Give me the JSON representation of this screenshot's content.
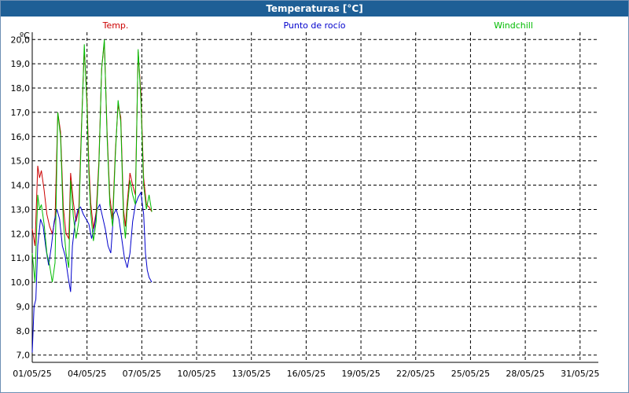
{
  "window": {
    "title": "Temperaturas [°C]"
  },
  "colors": {
    "titlebar": "#1e5f96",
    "temp": "#cc0000",
    "dew": "#0000cc",
    "windchill": "#00bb00"
  },
  "chart_data": {
    "type": "line",
    "title": "Temperaturas [°C]",
    "ylabel": "ºC",
    "xlabel": "",
    "ylim": [
      6.7,
      20.3
    ],
    "yticks": [
      "7,0",
      "8,0",
      "9,0",
      "10,0",
      "11,0",
      "12,0",
      "13,0",
      "14,0",
      "15,0",
      "16,0",
      "17,0",
      "18,0",
      "19,0",
      "20,0"
    ],
    "ytick_values": [
      7,
      8,
      9,
      10,
      11,
      12,
      13,
      14,
      15,
      16,
      17,
      18,
      19,
      20
    ],
    "xlim": [
      1,
      32
    ],
    "xticks": [
      "01/05/25",
      "04/05/25",
      "07/05/25",
      "10/05/25",
      "13/05/25",
      "16/05/25",
      "19/05/25",
      "22/05/25",
      "25/05/25",
      "28/05/25",
      "31/05/25"
    ],
    "xtick_values": [
      1,
      4,
      7,
      10,
      13,
      16,
      19,
      22,
      25,
      28,
      31
    ],
    "grid": true,
    "legend_position": "top",
    "series": [
      {
        "name": "Temp.",
        "color": "#cc0000",
        "x": [
          1.0,
          1.15,
          1.3,
          1.4,
          1.5,
          1.65,
          1.8,
          1.95,
          2.1,
          2.25,
          2.4,
          2.55,
          2.7,
          2.85,
          3.0,
          3.1,
          3.25,
          3.4,
          3.55,
          3.7,
          3.85,
          4.0,
          4.1,
          4.2,
          4.35,
          4.5,
          4.65,
          4.8,
          4.95,
          5.1,
          5.25,
          5.4,
          5.55,
          5.7,
          5.85,
          6.0,
          6.1,
          6.2,
          6.35,
          6.5,
          6.65,
          6.8,
          6.95,
          7.1,
          7.25,
          7.4,
          7.55
        ],
        "y": [
          12.2,
          11.5,
          14.8,
          14.3,
          14.6,
          13.8,
          12.8,
          12.3,
          12.0,
          12.6,
          17.0,
          16.2,
          13.1,
          12.0,
          11.8,
          14.5,
          13.3,
          12.5,
          13.0,
          16.5,
          19.6,
          17.5,
          14.9,
          13.3,
          12.2,
          12.9,
          15.0,
          18.8,
          19.9,
          16.2,
          13.5,
          12.6,
          15.4,
          17.3,
          16.8,
          13.0,
          12.3,
          13.3,
          14.5,
          14.0,
          13.6,
          19.5,
          17.8,
          14.3,
          13.2,
          13.1,
          12.9
        ]
      },
      {
        "name": "Punto de rocío",
        "color": "#0000cc",
        "x": [
          1.0,
          1.1,
          1.2,
          1.3,
          1.45,
          1.6,
          1.75,
          1.9,
          2.05,
          2.2,
          2.35,
          2.5,
          2.65,
          2.8,
          2.95,
          3.1,
          3.2,
          3.35,
          3.5,
          3.65,
          3.8,
          3.95,
          4.1,
          4.25,
          4.4,
          4.55,
          4.7,
          4.85,
          5.0,
          5.15,
          5.3,
          5.45,
          5.6,
          5.75,
          5.9,
          6.05,
          6.2,
          6.35,
          6.5,
          6.65,
          6.8,
          6.95,
          7.1,
          7.2,
          7.3,
          7.4,
          7.55
        ],
        "y": [
          7.1,
          9.0,
          9.3,
          11.5,
          12.6,
          12.3,
          11.4,
          10.7,
          11.5,
          12.5,
          13.0,
          12.6,
          11.5,
          11.1,
          10.3,
          9.6,
          11.5,
          12.5,
          13.0,
          13.1,
          12.8,
          12.6,
          12.4,
          11.8,
          12.3,
          13.0,
          13.2,
          12.7,
          12.2,
          11.5,
          11.2,
          12.8,
          13.0,
          12.6,
          11.8,
          11.0,
          10.6,
          11.2,
          12.5,
          13.2,
          13.5,
          13.7,
          12.8,
          11.2,
          10.5,
          10.2,
          10.0
        ]
      },
      {
        "name": "Windchill",
        "color": "#00bb00",
        "x": [
          1.0,
          1.15,
          1.3,
          1.4,
          1.5,
          1.65,
          1.8,
          1.95,
          2.1,
          2.25,
          2.4,
          2.55,
          2.7,
          2.85,
          3.0,
          3.1,
          3.25,
          3.4,
          3.55,
          3.7,
          3.85,
          4.0,
          4.1,
          4.2,
          4.35,
          4.5,
          4.65,
          4.8,
          4.95,
          5.1,
          5.25,
          5.4,
          5.55,
          5.7,
          5.85,
          6.0,
          6.1,
          6.2,
          6.35,
          6.5,
          6.65,
          6.8,
          6.95,
          7.1,
          7.25,
          7.4,
          7.55
        ],
        "y": [
          11.2,
          10.0,
          13.6,
          13.0,
          13.2,
          12.4,
          11.2,
          10.7,
          10.0,
          10.8,
          17.0,
          16.0,
          12.5,
          11.2,
          10.6,
          14.2,
          12.7,
          11.8,
          12.5,
          16.3,
          19.8,
          17.2,
          14.5,
          12.9,
          11.7,
          12.5,
          14.8,
          18.8,
          20.0,
          16.0,
          13.2,
          12.3,
          15.2,
          17.5,
          16.6,
          12.6,
          11.8,
          13.0,
          14.2,
          13.6,
          13.2,
          19.6,
          17.5,
          14.0,
          13.0,
          13.6,
          12.9
        ]
      }
    ]
  }
}
